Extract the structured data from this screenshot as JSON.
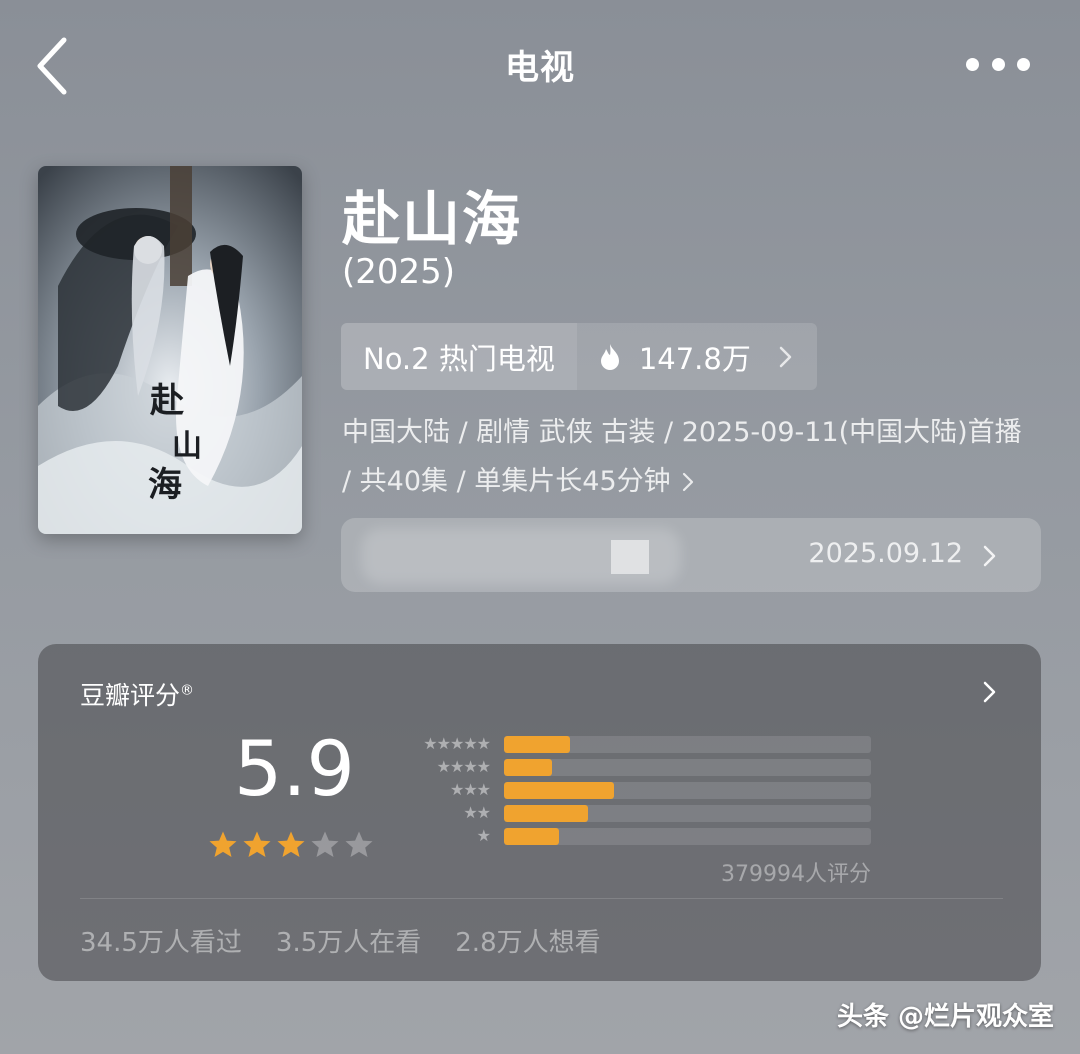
{
  "header": {
    "title": "电视",
    "back_icon": "chevron-left-icon",
    "more_icon": "more-dots-icon"
  },
  "show": {
    "title": "赴山海",
    "year": "(2025)",
    "poster_title": "赴山海"
  },
  "rank": {
    "label": "No.2 热门电视",
    "heat": "147.8万",
    "heat_icon": "flame-icon"
  },
  "meta": {
    "line": "中国大陆 / 剧情 武侠 古装 / 2025-09-11(中国大陆)首播 / 共40集 / 单集片长45分钟"
  },
  "release": {
    "date": "2025.09.12"
  },
  "rating": {
    "title": "豆瓣评分",
    "registered": "®",
    "score": "5.9",
    "stars_filled": 3,
    "stars_total": 5,
    "distribution": [
      {
        "stars": "★★★★★",
        "fraction": 0.18
      },
      {
        "stars": "★★★★",
        "fraction": 0.13
      },
      {
        "stars": "★★★",
        "fraction": 0.3
      },
      {
        "stars": "★★",
        "fraction": 0.23
      },
      {
        "stars": "★",
        "fraction": 0.15
      }
    ],
    "votes": "379994人评分",
    "accent_color": "#f0a32f"
  },
  "stats": {
    "watched": "34.5万人看过",
    "watching": "3.5万人在看",
    "want": "2.8万人想看"
  },
  "watermark": "头条 @烂片观众室"
}
